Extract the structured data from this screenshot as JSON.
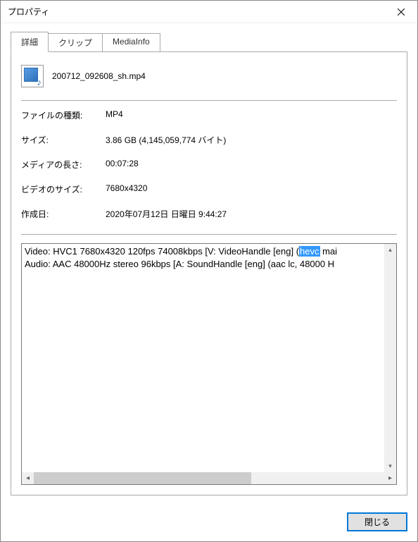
{
  "window": {
    "title": "プロパティ"
  },
  "tabs": {
    "details": "詳細",
    "clip": "クリップ",
    "mediainfo": "MediaInfo"
  },
  "file": {
    "name": "200712_092608_sh.mp4"
  },
  "labels": {
    "filetype": "ファイルの種類:",
    "size": "サイズ:",
    "duration": "メディアの長さ:",
    "video_size": "ビデオのサイズ:",
    "created": "作成日:"
  },
  "values": {
    "filetype": "MP4",
    "size": "3.86 GB (4,145,059,774 バイト)",
    "duration": "00:07:28",
    "video_size": "7680x4320",
    "created": "2020年07月12日 日曜日 9:44:27"
  },
  "media": {
    "video_pre": "Video: HVC1 7680x4320 120fps 74008kbps [V: VideoHandle [eng] (",
    "video_hl": "hevc",
    "video_post": " mai",
    "audio": "Audio: AAC 48000Hz stereo 96kbps [A: SoundHandle [eng] (aac lc, 48000 H"
  },
  "buttons": {
    "close": "閉じる"
  }
}
